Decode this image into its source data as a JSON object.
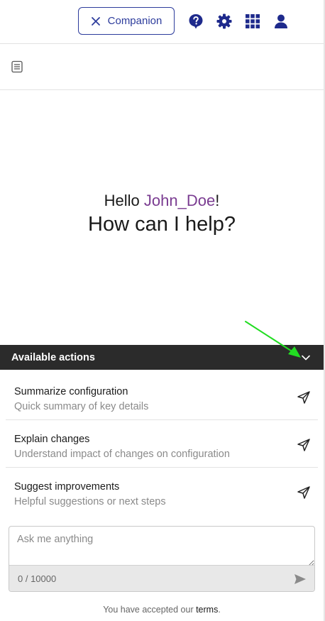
{
  "topbar": {
    "companion_label": "Companion",
    "icons": [
      "help-icon",
      "gear-icon",
      "apps-grid-icon",
      "user-icon"
    ]
  },
  "subbar": {
    "icon": "document-icon"
  },
  "greeting": {
    "hello": "Hello ",
    "username": "John_Doe",
    "exclaim": "!",
    "prompt": "How can I help?"
  },
  "actions": {
    "header": "Available actions",
    "items": [
      {
        "title": "Summarize configuration",
        "subtitle": "Quick summary of key details"
      },
      {
        "title": "Explain changes",
        "subtitle": "Understand impact of changes on configuration"
      },
      {
        "title": "Suggest improvements",
        "subtitle": "Helpful suggestions or next steps"
      }
    ]
  },
  "chat": {
    "placeholder": "Ask me anything",
    "counter": "0 / 10000"
  },
  "terms": {
    "prefix": "You have accepted our ",
    "link": "terms",
    "suffix": "."
  },
  "colors": {
    "brand": "#2d3c9c",
    "username": "#7a3c91",
    "header_bg": "#2b2b2b",
    "annotation_arrow": "#22dd22"
  }
}
